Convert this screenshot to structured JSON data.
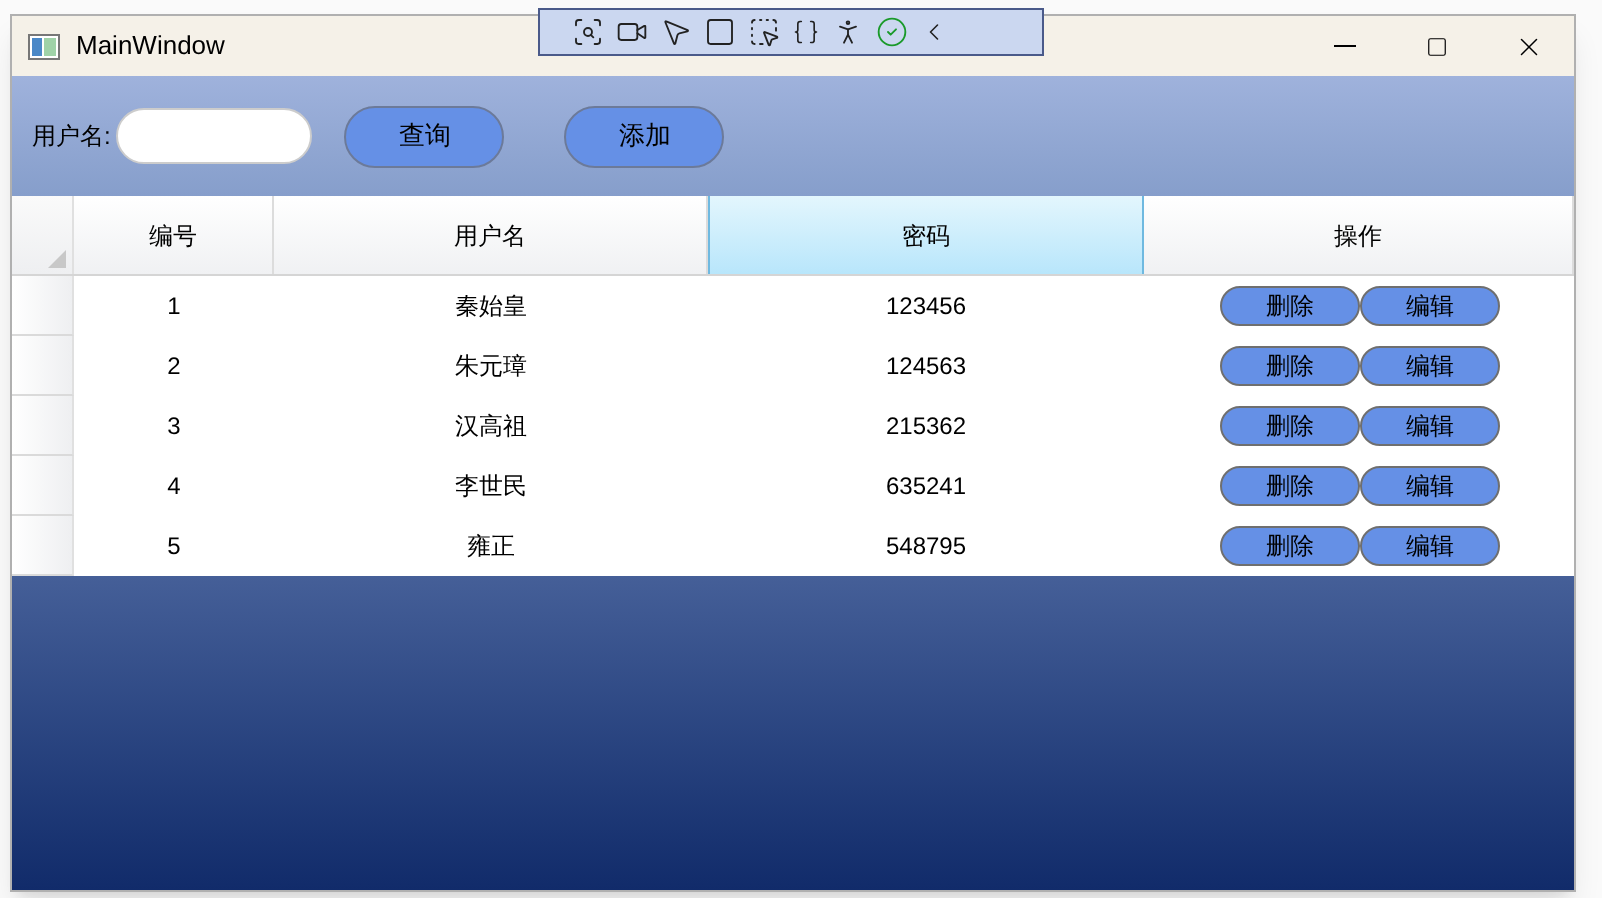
{
  "window": {
    "title": "MainWindow"
  },
  "search_bar": {
    "label": "用户名:",
    "query_button": "查询",
    "add_button": "添加"
  },
  "table": {
    "columns": [
      {
        "label": "编号",
        "selected": false
      },
      {
        "label": "用户名",
        "selected": false
      },
      {
        "label": "密码",
        "selected": true
      },
      {
        "label": "操作",
        "selected": false
      }
    ],
    "rows": [
      {
        "id": "1",
        "username": "秦始皇",
        "password": "123456",
        "actions": [
          "删除",
          "编辑"
        ]
      },
      {
        "id": "2",
        "username": "朱元璋",
        "password": "124563",
        "actions": [
          "删除",
          "编辑"
        ]
      },
      {
        "id": "3",
        "username": "汉高祖",
        "password": "215362",
        "actions": [
          "删除",
          "编辑"
        ]
      },
      {
        "id": "4",
        "username": "李世民",
        "password": "635241",
        "actions": [
          "删除",
          "编辑"
        ]
      },
      {
        "id": "5",
        "username": "雍正",
        "password": "548795",
        "actions": [
          "删除",
          "编辑"
        ]
      }
    ]
  }
}
